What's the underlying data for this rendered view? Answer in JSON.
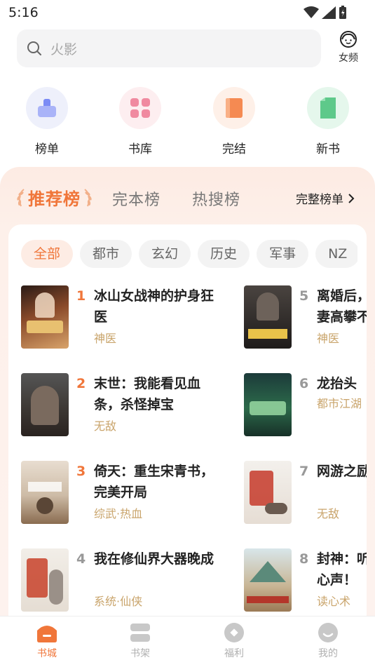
{
  "status_bar": {
    "time": "5:16"
  },
  "search": {
    "placeholder_text": "火影"
  },
  "female_channel": {
    "label": "女频"
  },
  "quick_nav": [
    {
      "label": "榜单",
      "icon": "ranking-icon",
      "color": "#7b8bf5"
    },
    {
      "label": "书库",
      "icon": "library-icon",
      "color": "#f08aa0"
    },
    {
      "label": "完结",
      "icon": "book-icon",
      "color": "#f58a52"
    },
    {
      "label": "新书",
      "icon": "new-book-icon",
      "color": "#5ec98a"
    }
  ],
  "rank_tabs": {
    "active": "推荐榜",
    "others": [
      "完本榜",
      "热搜榜"
    ],
    "full_rank": "完整榜单"
  },
  "genres": {
    "active": "全部",
    "items": [
      "全部",
      "都市",
      "玄幻",
      "历史",
      "军事",
      "NZ"
    ]
  },
  "books": [
    {
      "rank": "1",
      "title": "冰山女战神的护身狂医",
      "tag": "神医"
    },
    {
      "rank": "2",
      "title": "末世：我能看见血条，杀怪掉宝",
      "tag": "无敌"
    },
    {
      "rank": "3",
      "title": "倚天：重生宋青书，完美开局",
      "tag": "综武·热血"
    },
    {
      "rank": "4",
      "title": "我在修仙界大器晚成",
      "tag": "系统·仙侠"
    },
    {
      "rank": "5",
      "title": "离婚后，妻高攀不",
      "tag": "神医"
    },
    {
      "rank": "6",
      "title": "龙抬头",
      "tag": "都市江湖"
    },
    {
      "rank": "7",
      "title": "网游之励",
      "tag": "无敌"
    },
    {
      "rank": "8",
      "title": "封神：听心声！",
      "tag": "读心术"
    }
  ],
  "bottom_tabs": [
    {
      "label": "书城",
      "active": true
    },
    {
      "label": "书架",
      "active": false
    },
    {
      "label": "福利",
      "active": false
    },
    {
      "label": "我的",
      "active": false
    }
  ],
  "colors": {
    "accent": "#f0763a",
    "rank_top": "#f0763a",
    "rank_other": "#999999",
    "tag": "#c9a46b"
  }
}
